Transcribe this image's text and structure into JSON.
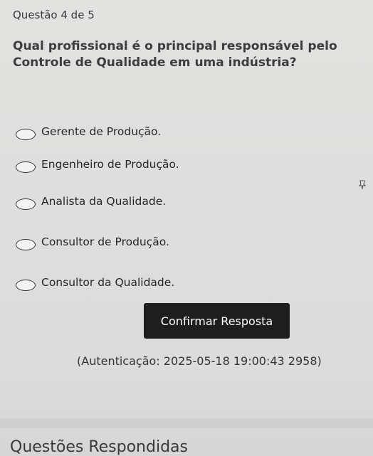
{
  "header": {
    "counter": "Questão 4 de 5"
  },
  "question": {
    "text": "Qual profissional é o principal responsável pelo Controle de Qualidade em uma indústria?"
  },
  "options": [
    {
      "label": "Gerente de Produção."
    },
    {
      "label": "Engenheiro de Produção."
    },
    {
      "label": "Analista da Qualidade."
    },
    {
      "label": "Consultor de Produção."
    },
    {
      "label": "Consultor da Qualidade."
    }
  ],
  "actions": {
    "confirm_label": "Confirmar Resposta"
  },
  "footer": {
    "auth_text": "(Autenticação: 2025-05-18 19:00:43 2958)",
    "answered_label": "Questões Respondidas"
  },
  "icons": {
    "pin": "pin-icon"
  }
}
